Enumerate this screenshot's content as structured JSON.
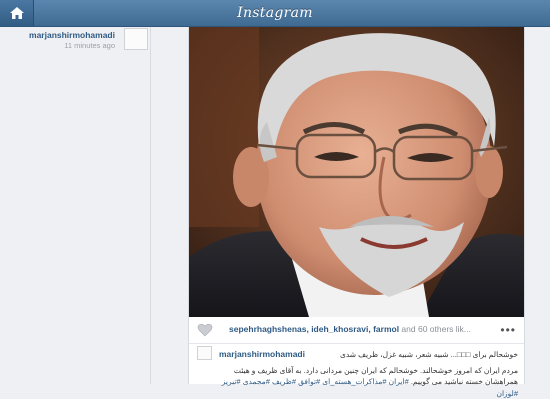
{
  "app": {
    "title": "Instagram"
  },
  "header": {
    "home_icon": "home-icon"
  },
  "post": {
    "username": "marjanshirmohamadi",
    "time_ago": "11 minutes ago",
    "likes": {
      "users": "sepehrhaghshenas, ideh_khosravi, farmol",
      "suffix": " and 60 others lik..."
    },
    "more_label": "•••",
    "comment": {
      "username": "marjanshirmohamadi",
      "line1": "خوشحالم برای □□□... شبیه شعر، شبیه غزل، ظریف شدی",
      "line2": "مردم ایران که امروز خوشحالند. خوشحالم که ایران چنین مردانی دارد. به آقای ظریف و هیئت",
      "line3_text": "همراهشان خسته نباشید می گوییم.",
      "line3_tags": " #ایران #مذاکرات_هسته_ای #توافق #ظریف #مجمدی #تبریز #لوزان"
    }
  },
  "colors": {
    "accent": "#2f5a85",
    "topbar": "#4a77a0"
  }
}
